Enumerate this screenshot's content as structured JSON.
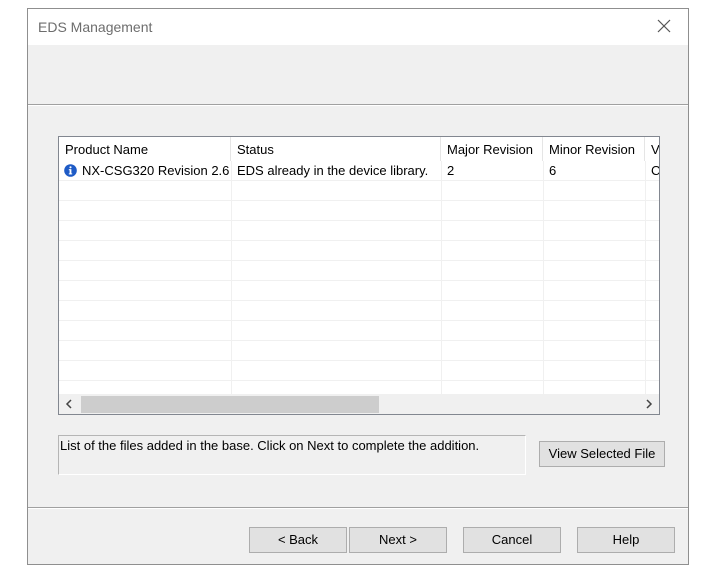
{
  "window": {
    "title": "EDS Management"
  },
  "list": {
    "columns": [
      {
        "label": "Product Name"
      },
      {
        "label": "Status"
      },
      {
        "label": "Major Revision"
      },
      {
        "label": "Minor Revision"
      },
      {
        "label": "V"
      }
    ],
    "rows": [
      {
        "icon": "info-icon",
        "product_name": "NX-CSG320 Revision 2.6",
        "status": "EDS already in the device library.",
        "major_revision": "2",
        "minor_revision": "6",
        "v": "C"
      }
    ],
    "horizontal_scroll_position": 0.0
  },
  "message": "List of the files added in the base. Click on Next to complete the addition.",
  "buttons": {
    "view_selected_file": "View Selected File",
    "back": "< Back",
    "next": "Next >",
    "cancel": "Cancel",
    "help": "Help"
  },
  "colors": {
    "dialog_bg": "#f0f0f0",
    "info_icon": "#1e5bc6",
    "button_bg": "#e1e1e1",
    "scroll_thumb": "#cdcdcd"
  }
}
